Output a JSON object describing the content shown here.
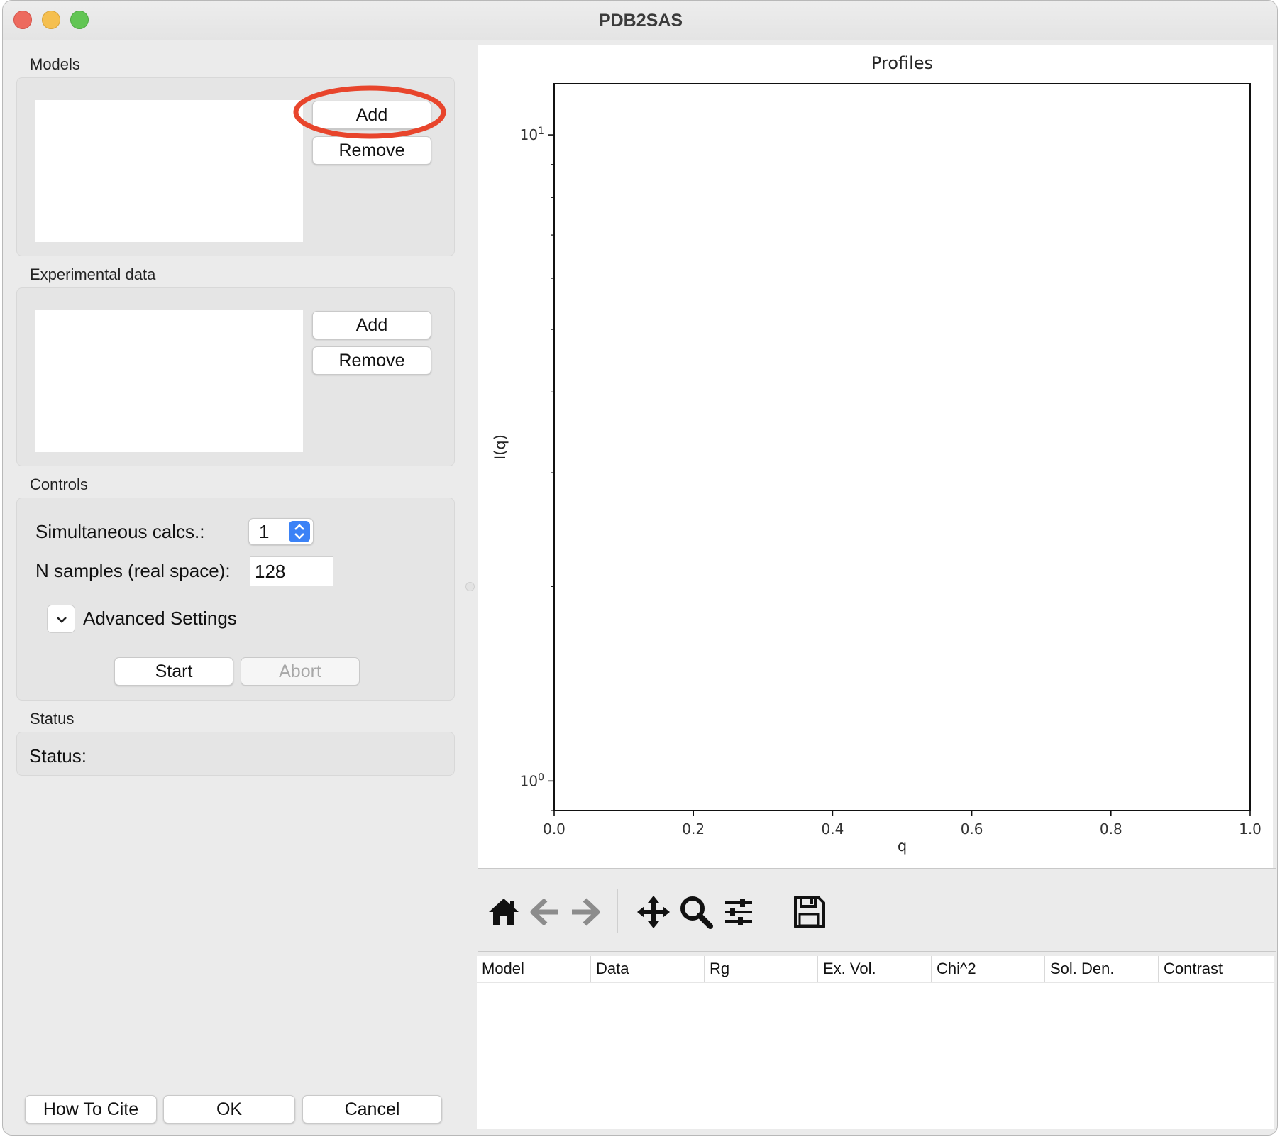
{
  "window": {
    "title": "PDB2SAS"
  },
  "models": {
    "label": "Models",
    "add_label": "Add",
    "remove_label": "Remove"
  },
  "experimental": {
    "label": "Experimental data",
    "add_label": "Add",
    "remove_label": "Remove"
  },
  "controls": {
    "label": "Controls",
    "simultaneous_label": "Simultaneous calcs.:",
    "simultaneous_value": "1",
    "nsamples_label": "N samples (real space):",
    "nsamples_value": "128",
    "advanced_label": "Advanced Settings",
    "start_label": "Start",
    "abort_label": "Abort"
  },
  "status": {
    "label": "Status",
    "text": "Status:"
  },
  "footer": {
    "cite_label": "How To Cite",
    "ok_label": "OK",
    "cancel_label": "Cancel"
  },
  "chart_data": {
    "type": "line",
    "title": "Profiles",
    "xlabel": "q",
    "ylabel": "I(q)",
    "xlim": [
      0.0,
      1.0
    ],
    "ylim": [
      0.9,
      12
    ],
    "yscale": "log",
    "x_ticks": [
      "0.0",
      "0.2",
      "0.4",
      "0.6",
      "0.8",
      "1.0"
    ],
    "y_ticks": [
      {
        "base": "10",
        "exp": "1",
        "value": 10
      },
      {
        "base": "10",
        "exp": "0",
        "value": 1
      }
    ],
    "series": [],
    "grid": false
  },
  "toolbar": {
    "icons": [
      "home-icon",
      "back-arrow-icon",
      "forward-arrow-icon",
      "pan-icon",
      "zoom-icon",
      "configure-subplots-icon",
      "save-icon"
    ]
  },
  "results_table": {
    "columns": [
      "Model",
      "Data",
      "Rg",
      "Ex. Vol.",
      "Chi^2",
      "Sol. Den.",
      "Contrast"
    ],
    "rows": []
  },
  "colors": {
    "annotation": "#e8452c",
    "spin_accent": "#3b82f6"
  }
}
